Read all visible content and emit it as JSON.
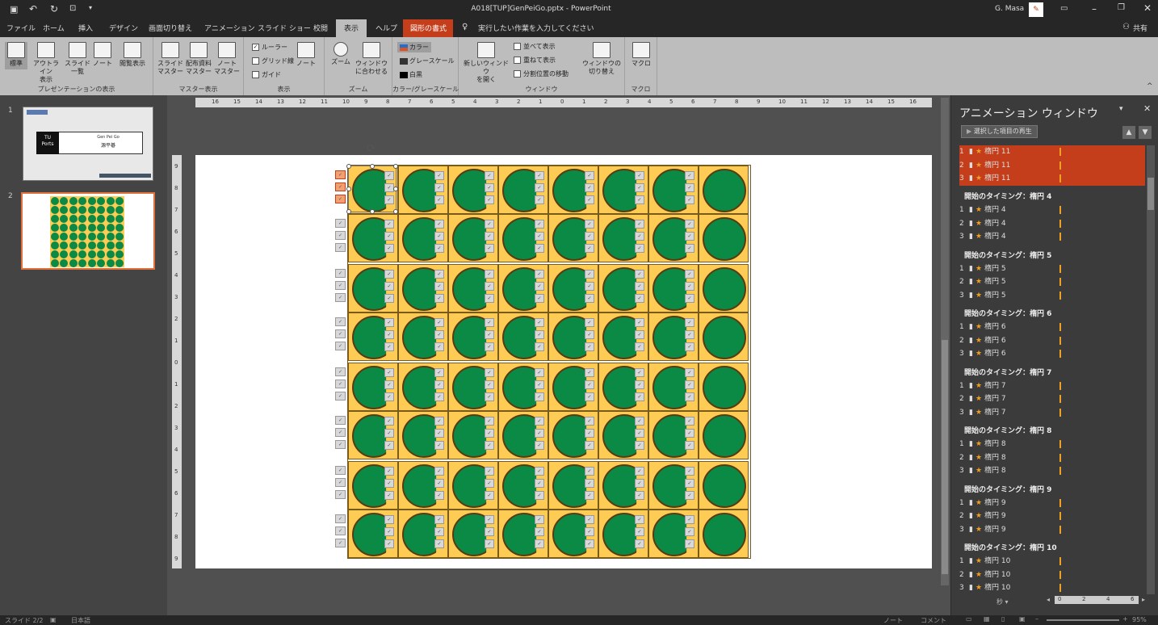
{
  "title": {
    "file": "A018[TUP]GenPeiGo.pptx - PowerPoint",
    "user": "G. Masa"
  },
  "tabs": [
    "ファイル",
    "ホーム",
    "挿入",
    "デザイン",
    "画面切り替え",
    "アニメーション",
    "スライド ショー",
    "校閲",
    "表示",
    "ヘルプ",
    "図形の書式"
  ],
  "tell_me": "実行したい作業を入力してください",
  "share": "共有",
  "ribbon": {
    "g1": {
      "buttons": [
        "標準",
        "アウトライン\n表示",
        "スライド\n一覧",
        "ノート",
        "閲覧表示"
      ],
      "label": "プレゼンテーションの表示"
    },
    "g2": {
      "buttons": [
        "スライド\nマスター",
        "配布資料\nマスター",
        "ノート\nマスター"
      ],
      "label": "マスター表示"
    },
    "g3": {
      "checks": [
        "ルーラー",
        "グリッド線",
        "ガイド"
      ],
      "note": "ノート",
      "label": "表示"
    },
    "g4": {
      "buttons": [
        "ズーム",
        "ウィンドウ\nに合わせる"
      ],
      "label": "ズーム"
    },
    "g5": {
      "items": [
        "カラー",
        "グレースケール",
        "白黒"
      ],
      "label": "カラー/グレースケール"
    },
    "g6": {
      "new_window": "新しいウィンドウ\nを開く",
      "items": [
        "並べて表示",
        "重ねて表示",
        "分割位置の移動"
      ],
      "switch": "ウィンドウの\n切り替え",
      "label": "ウィンドウ"
    },
    "g7": {
      "button": "マクロ",
      "label": "マクロ"
    }
  },
  "thumbs": {
    "n1": "1",
    "n2": "2",
    "t1_logo": "TU\nPorts",
    "t1_a": "Gen Pei Go",
    "t1_b": "源平碁"
  },
  "hruler": [
    "16",
    "15",
    "14",
    "13",
    "12",
    "11",
    "10",
    "9",
    "8",
    "7",
    "6",
    "5",
    "4",
    "3",
    "2",
    "1",
    "0",
    "1",
    "2",
    "3",
    "4",
    "5",
    "6",
    "7",
    "8",
    "9",
    "10",
    "11",
    "12",
    "13",
    "14",
    "15",
    "16"
  ],
  "vruler": [
    "9",
    "8",
    "7",
    "6",
    "5",
    "4",
    "3",
    "2",
    "1",
    "0",
    "1",
    "2",
    "3",
    "4",
    "5",
    "6",
    "7",
    "8",
    "9"
  ],
  "anim": {
    "title": "アニメーション ウィンドウ",
    "play": "選択した項目の再生",
    "selected": [
      {
        "n": "1",
        "t": "楕円 11"
      },
      {
        "n": "2",
        "t": "楕円 11"
      },
      {
        "n": "3",
        "t": "楕円 11"
      }
    ],
    "groups": [
      {
        "head": "開始のタイミング：楕円 4",
        "items": [
          "楕円 4",
          "楕円 4",
          "楕円 4"
        ]
      },
      {
        "head": "開始のタイミング：楕円 5",
        "items": [
          "楕円 5",
          "楕円 5",
          "楕円 5"
        ]
      },
      {
        "head": "開始のタイミング：楕円 6",
        "items": [
          "楕円 6",
          "楕円 6",
          "楕円 6"
        ]
      },
      {
        "head": "開始のタイミング：楕円 7",
        "items": [
          "楕円 7",
          "楕円 7",
          "楕円 7"
        ]
      },
      {
        "head": "開始のタイミング：楕円 8",
        "items": [
          "楕円 8",
          "楕円 8",
          "楕円 8"
        ]
      },
      {
        "head": "開始のタイミング：楕円 9",
        "items": [
          "楕円 9",
          "楕円 9",
          "楕円 9"
        ]
      },
      {
        "head": "開始のタイミング：楕円 10",
        "items": [
          "楕円 10",
          "楕円 10",
          "楕円 10"
        ]
      }
    ],
    "seconds": "秒",
    "timeline": [
      "0",
      "2",
      "4",
      "6"
    ]
  },
  "status": {
    "slide": "スライド 2/2",
    "lang": "日本語",
    "notes": "ノート",
    "comments": "コメント",
    "zoom": "95%"
  },
  "colors": {
    "accent": "#c43e1c",
    "circle": "#0a8a44",
    "cell": "#fecc54"
  }
}
